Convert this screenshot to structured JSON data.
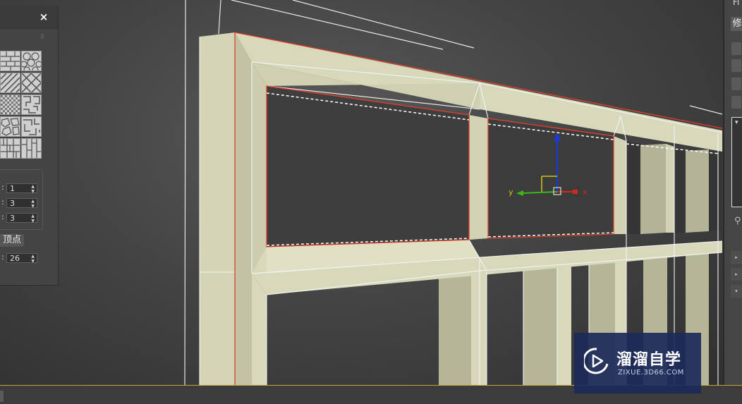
{
  "floating_panel": {
    "close_symbol": "×",
    "textures": [
      "brick-pattern",
      "hex-pattern",
      "brick-pattern",
      "diagonal-tile-pattern",
      "checker-pattern",
      "maze-pattern",
      "stone-pattern",
      "maze-pattern",
      "grid-tile-pattern",
      "parquet-pattern"
    ],
    "spinners": [
      {
        "colon": ":",
        "value": "1"
      },
      {
        "colon": ":",
        "value": "3"
      },
      {
        "colon": ":",
        "value": "3"
      }
    ],
    "vertex_button_label": "顶点",
    "last_spinner": {
      "colon": ":",
      "value": "26"
    }
  },
  "right_panel": {
    "top_label": "Fi",
    "modify_label": "修",
    "arrow_symbols": [
      "▸",
      "▸",
      "▾"
    ],
    "list_arrow": "▾"
  },
  "gizmo": {
    "x_label": "x",
    "y_label": "y"
  },
  "watermark": {
    "title": "溜溜自学",
    "url": "ZIXUE.3D66.COM"
  },
  "colors": {
    "frame_face": "#d8d8bb",
    "frame_shade": "#b3b397",
    "selection_edge": "#e0402a",
    "wire": "#f2f2f2",
    "gizmo_x": "#d42a1a",
    "gizmo_y": "#3fb51c",
    "gizmo_z": "#1a3adf"
  }
}
